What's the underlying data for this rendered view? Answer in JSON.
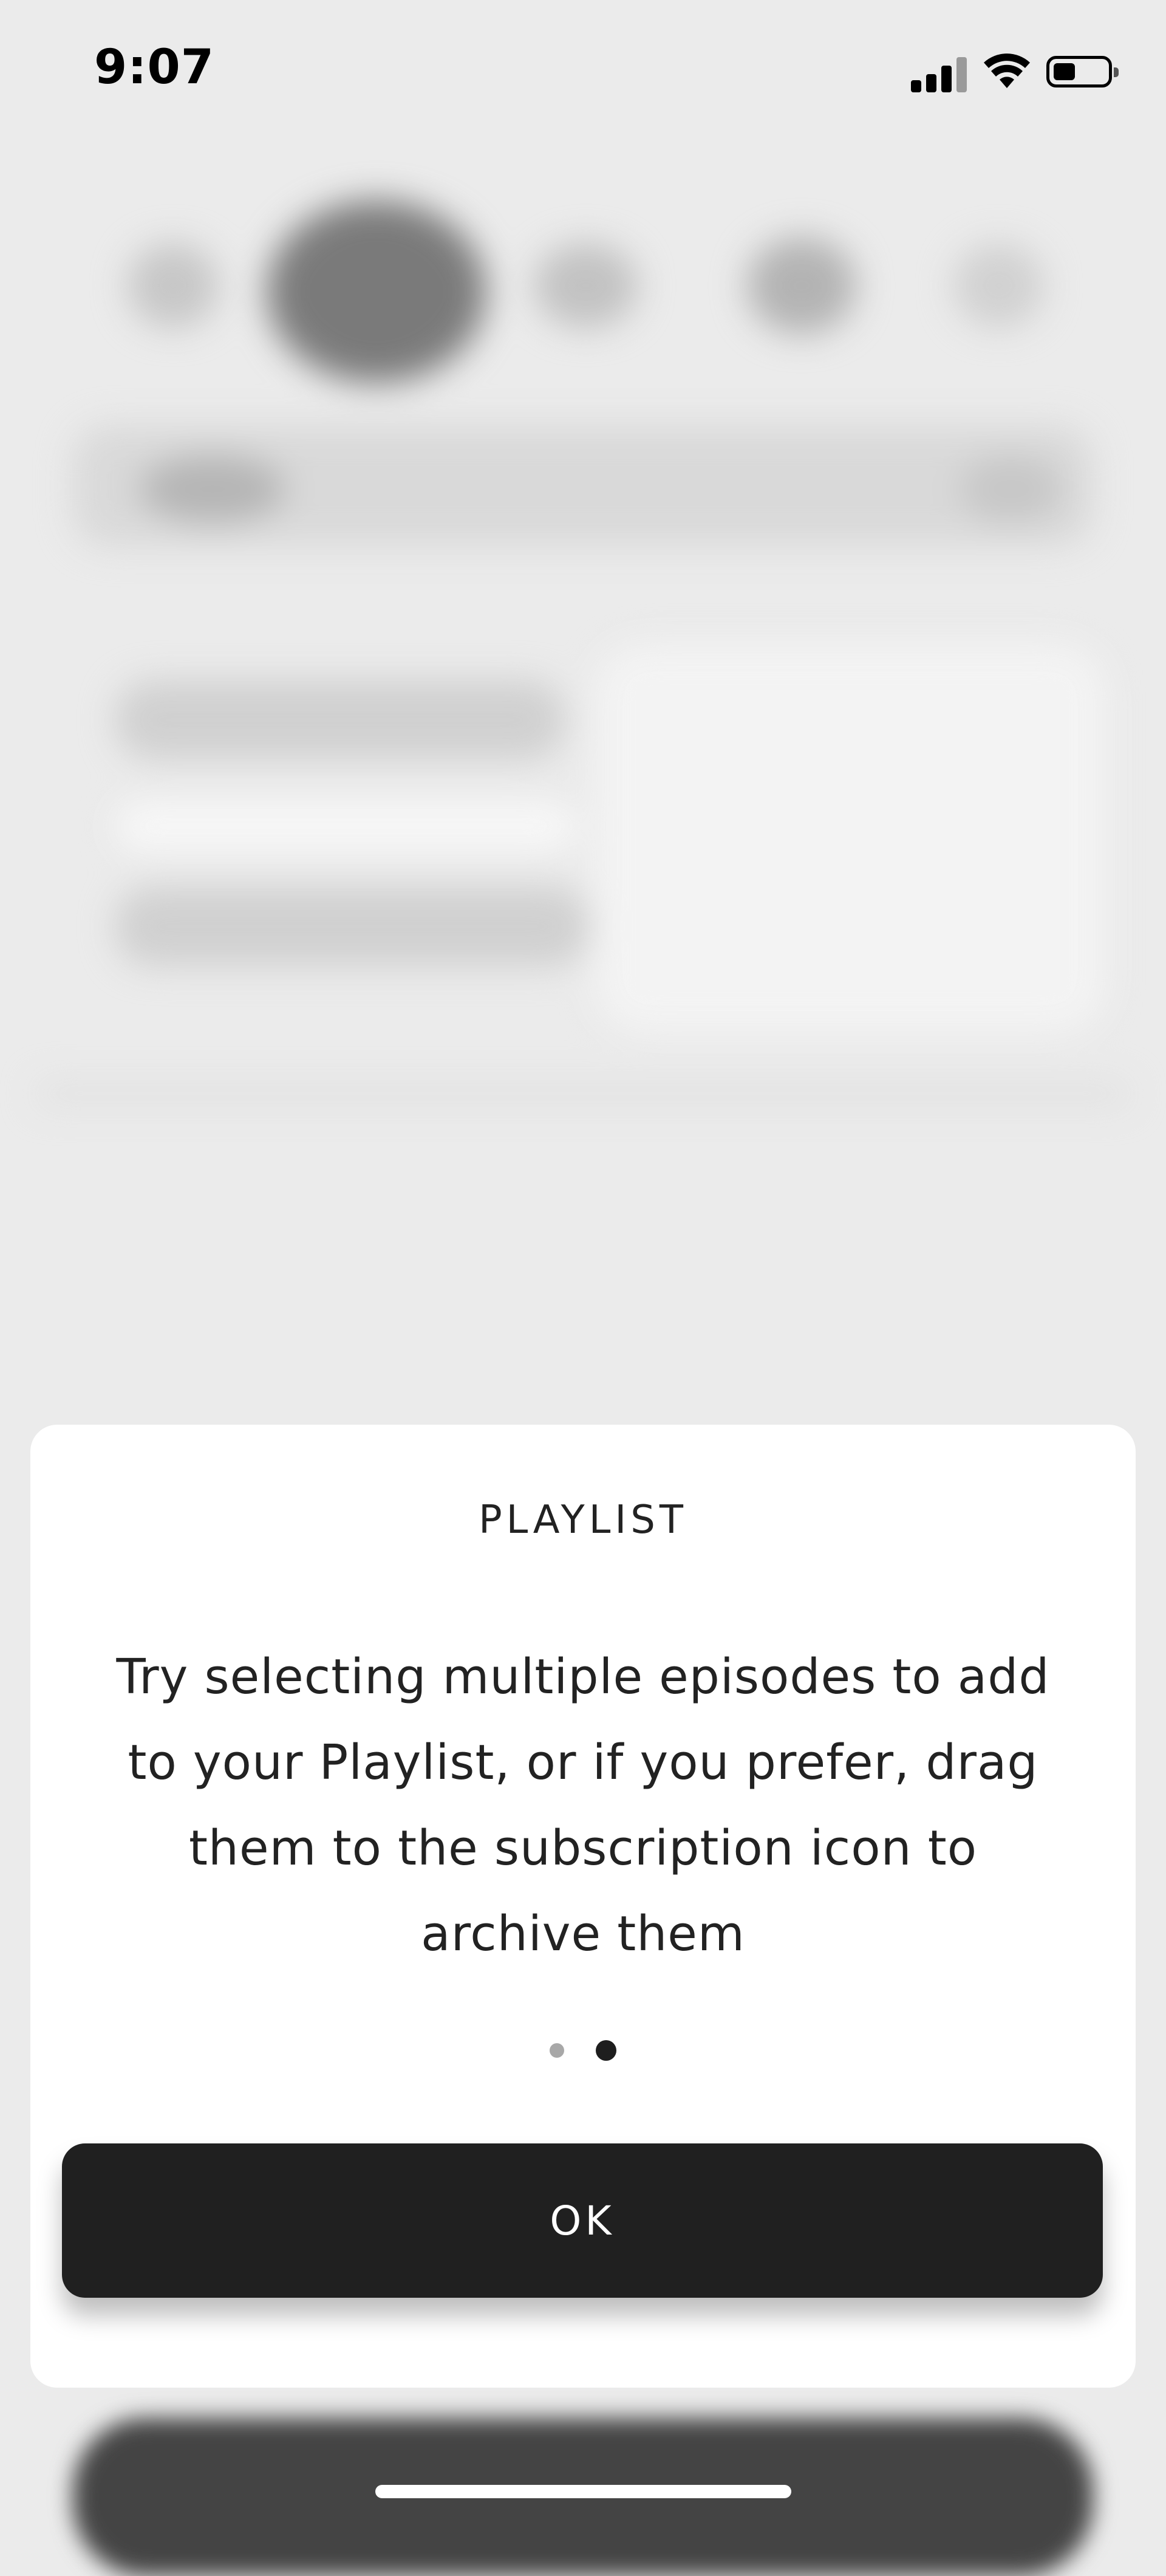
{
  "status_bar": {
    "time": "9:07",
    "signal_icon": "cellular-signal-icon",
    "wifi_icon": "wifi-icon",
    "battery_icon": "battery-icon"
  },
  "sheet": {
    "title": "PLAYLIST",
    "message": "Try selecting multiple episodes to add to your Playlist, or if you prefer, drag them to the subscription icon to archive them",
    "page_count": 2,
    "current_page": 2,
    "ok_label": "OK"
  },
  "colors": {
    "sheet_background": "#ffffff",
    "button_background": "#202020",
    "button_text": "#ffffff",
    "active_dot": "#1e1e1e",
    "inactive_dot": "#a8a8a8"
  }
}
